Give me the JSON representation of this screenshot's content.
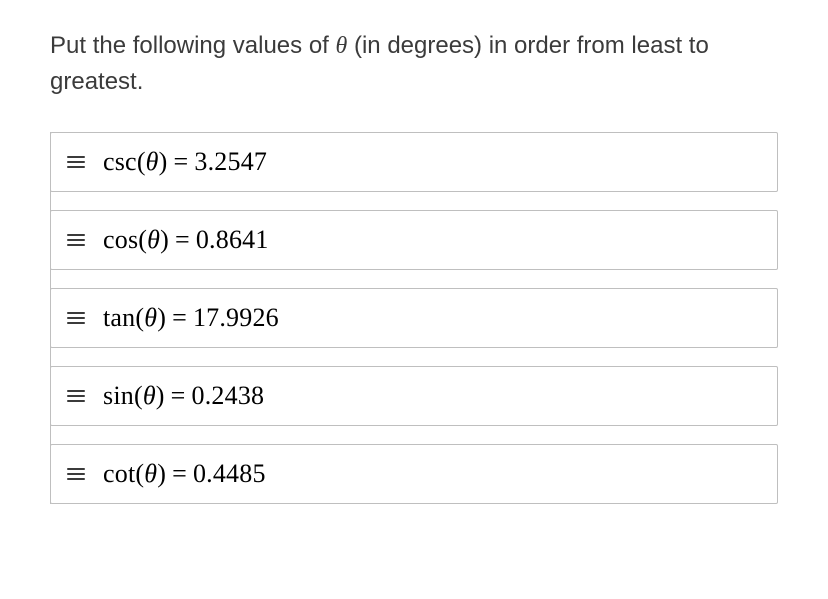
{
  "prompt": {
    "before_theta": "Put the following values of ",
    "theta": "θ",
    "after_theta": " (in degrees) in order from least to greatest."
  },
  "items": [
    {
      "fn": "csc",
      "var": "θ",
      "eq": "=",
      "val": "3.2547"
    },
    {
      "fn": "cos",
      "var": "θ",
      "eq": "=",
      "val": "0.8641"
    },
    {
      "fn": "tan",
      "var": "θ",
      "eq": "=",
      "val": "17.9926"
    },
    {
      "fn": "sin",
      "var": "θ",
      "eq": "=",
      "val": "0.2438"
    },
    {
      "fn": "cot",
      "var": "θ",
      "eq": "=",
      "val": "0.4485"
    }
  ]
}
